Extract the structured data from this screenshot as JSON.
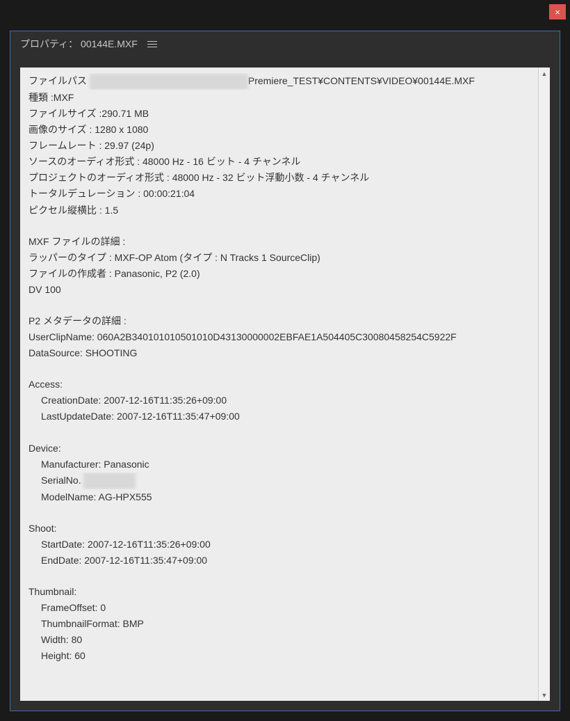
{
  "window": {
    "close_glyph": "×"
  },
  "panel": {
    "title": "プロパティ： 00144E.MXF"
  },
  "props": {
    "file_path_label": "ファイルパス",
    "file_path_tail": "Premiere_TEST¥CONTENTS¥VIDEO¥00144E.MXF",
    "type_line": "種類 :MXF",
    "file_size_line": "ファイルサイズ :290.71 MB",
    "image_size_line": "画像のサイズ : 1280 x 1080",
    "frame_rate_line": "フレームレート : 29.97 (24p)",
    "source_audio_line": "ソースのオーディオ形式 : 48000 Hz - 16 ビット - 4 チャンネル",
    "project_audio_line": "プロジェクトのオーディオ形式 : 48000 Hz - 32 ビット浮動小数 - 4 チャンネル",
    "total_duration_line": "トータルデュレーション : 00:00:21:04",
    "pixel_aspect_line": "ピクセル縦横比 : 1.5",
    "mxf_section_title": "MXF ファイルの詳細 :",
    "wrapper_type_line": "ラッパーのタイプ : MXF-OP Atom (タイプ : N Tracks 1 SourceClip)",
    "file_creator_line": "ファイルの作成者 : Panasonic, P2 (2.0)",
    "dv100_line": "DV 100",
    "p2_section_title": "P2 メタデータの詳細 :",
    "user_clip_name_line": "UserClipName: 060A2B340101010501010D43130000002EBFAE1A504405C30080458254C5922F",
    "data_source_line": "DataSource: SHOOTING",
    "access_header": "Access:",
    "creation_date_line": "CreationDate: 2007-12-16T11:35:26+09:00",
    "last_update_line": "LastUpdateDate: 2007-12-16T11:35:47+09:00",
    "device_header": "Device:",
    "manufacturer_line": "Manufacturer: Panasonic",
    "serial_label": "SerialNo.",
    "model_name_line": "ModelName: AG-HPX555",
    "shoot_header": "Shoot:",
    "start_date_line": "StartDate: 2007-12-16T11:35:26+09:00",
    "end_date_line": "EndDate: 2007-12-16T11:35:47+09:00",
    "thumbnail_header": "Thumbnail:",
    "frame_offset_line": "FrameOffset: 0",
    "thumbnail_format_line": "ThumbnailFormat: BMP",
    "width_line": "Width: 80",
    "height_line": "Height: 60"
  }
}
